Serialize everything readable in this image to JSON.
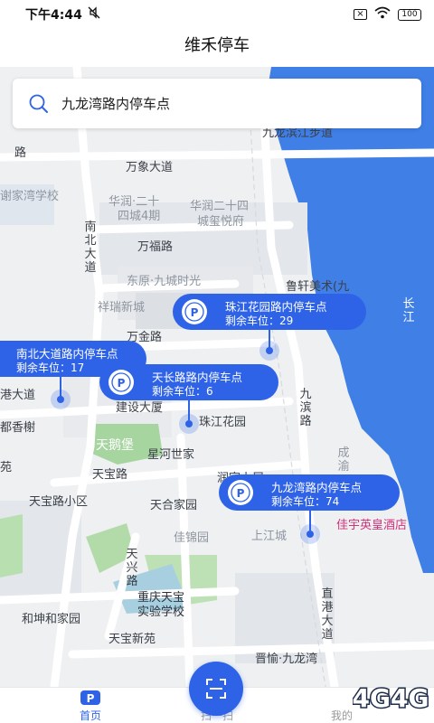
{
  "status_bar": {
    "time": "下午4:44",
    "battery": "100",
    "icons": [
      "mute-icon",
      "close-box-icon",
      "wifi-icon",
      "battery-icon"
    ]
  },
  "header": {
    "title": "维禾停车"
  },
  "search": {
    "value": "九龙湾路内停车点",
    "icon": "search-icon"
  },
  "map": {
    "labels": {
      "wanzai": "万象大道",
      "huarun1": "华润·二十",
      "huarun1b": "四城4期",
      "huarun2": "华润二十四",
      "huarun2b": "城玺悦府",
      "xiejia": "谢家湾学校",
      "nanbei": "南北大道",
      "wanfu": "万福路",
      "dongyuan": "东原·九城时光",
      "xiangrui": "祥瑞新城",
      "wanjin": "万金路",
      "luxuan": "鲁轩美术(九",
      "changjiang": "长江",
      "jianshe": "建设大厦",
      "zhujiang": "珠江花园",
      "jiubin": "九滨路",
      "gangda": "港大道",
      "dudu": "都香榭",
      "tiane": "天鹅堡",
      "xinghe": "星河世家",
      "chengyu": "成渝",
      "runyu": "润宇上屋",
      "tianbao": "天宝路",
      "tianbaoxq": "天宝路小区",
      "tianhe": "天合家园",
      "jiajin": "佳锦园",
      "shangjiang": "上江城",
      "jiayu": "佳宇英皇酒店",
      "tianxing": "天兴路",
      "chongqing1": "重庆天宝",
      "chongqing2": "实验学校",
      "hekun": "和坤和家园",
      "tianbaoxy": "天宝新苑",
      "zhigang": "直港大道",
      "jinyu": "晋愉·九龙湾",
      "jiulong_poi": "九龙滨江步道",
      "road_top": "道",
      "road_lu": "路",
      "road_yuan": "苑"
    },
    "colors": {
      "water": "#3f7fe6",
      "green": "#a7d5a0",
      "accent": "#2f63e7"
    }
  },
  "callouts": [
    {
      "name": "珠江花园路内停车点",
      "remaining": "剩余车位：29"
    },
    {
      "name": "南北大道路内停车点",
      "remaining": "剩余车位：17"
    },
    {
      "name": "天长路路内停车点",
      "remaining": "剩余车位：6"
    },
    {
      "name": "九龙湾路内停车点",
      "remaining": "剩余车位：74"
    }
  ],
  "tabbar": {
    "home_label": "首页",
    "mine_label": "我的",
    "middle_label": "扫一扫",
    "icons": [
      "parking-icon",
      "scan-icon",
      "user-icon"
    ]
  },
  "watermark": {
    "text": "4G4G"
  }
}
